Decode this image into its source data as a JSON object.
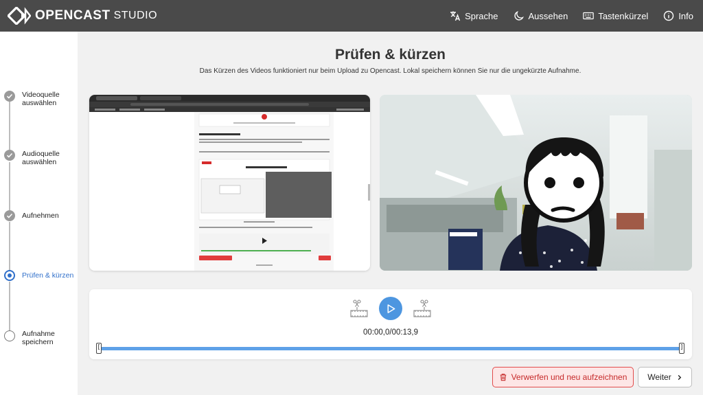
{
  "header": {
    "logo_main": "OPENCAST",
    "logo_sub": "STUDIO",
    "nav": [
      {
        "label": "Sprache",
        "icon": "translate-icon"
      },
      {
        "label": "Aussehen",
        "icon": "moon-icon"
      },
      {
        "label": "Tastenkürzel",
        "icon": "keyboard-icon"
      },
      {
        "label": "Info",
        "icon": "info-icon"
      }
    ]
  },
  "steps": [
    {
      "label": "Videoquelle auswählen",
      "state": "done"
    },
    {
      "label": "Audioquelle auswählen",
      "state": "done"
    },
    {
      "label": "Aufnehmen",
      "state": "done"
    },
    {
      "label": "Prüfen & kürzen",
      "state": "active"
    },
    {
      "label": "Aufnahme speichern",
      "state": "todo"
    }
  ],
  "main": {
    "title": "Prüfen & kürzen",
    "subtitle": "Das Kürzen des Videos funktioniert nur beim Upload zu Opencast. Lokal speichern können Sie nur die ungekürzte Aufnahme."
  },
  "player": {
    "time": "00:00,0/00:13,9",
    "trim_start_glyph": "[",
    "trim_end_glyph": "]"
  },
  "actions": {
    "discard_label": "Verwerfen und neu aufzeichnen",
    "next_label": "Weiter"
  },
  "colors": {
    "header_bg": "#4a4a4a",
    "accent": "#4d96e0",
    "active_step": "#2f6fca",
    "danger": "#e24b4b"
  }
}
